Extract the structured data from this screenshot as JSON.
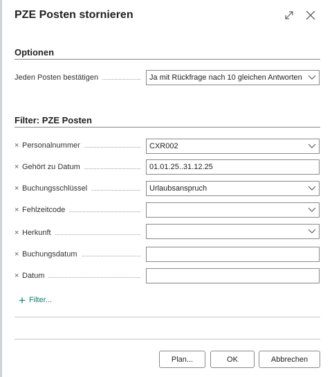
{
  "dialog": {
    "title": "PZE Posten stornieren",
    "icons": {
      "expand": "expand-icon",
      "close": "close-icon"
    }
  },
  "options": {
    "section_title": "Optionen",
    "confirm_label": "Jeden Posten bestätigen",
    "confirm_value": "Ja mit Rückfrage nach 10 gleichen Antworten"
  },
  "filter": {
    "section_title": "Filter: PZE Posten",
    "rows": [
      {
        "label": "Personalnummer",
        "value": "CXR002",
        "kind": "select"
      },
      {
        "label": "Gehört zu Datum",
        "value": "01.01.25..31.12.25",
        "kind": "text"
      },
      {
        "label": "Buchungsschlüssel",
        "value": "Urlaubsanspruch",
        "kind": "select"
      },
      {
        "label": "Fehlzeitcode",
        "value": "",
        "kind": "select"
      },
      {
        "label": "Herkunft",
        "value": "",
        "kind": "select"
      },
      {
        "label": "Buchungsdatum",
        "value": "",
        "kind": "text"
      },
      {
        "label": "Datum",
        "value": "",
        "kind": "text"
      }
    ],
    "add_filter_label": "Filter..."
  },
  "footer": {
    "plan_label": "Plan...",
    "ok_label": "OK",
    "cancel_label": "Abbrechen"
  },
  "colors": {
    "accent": "#0f7b6c",
    "border": "#8a8886"
  }
}
